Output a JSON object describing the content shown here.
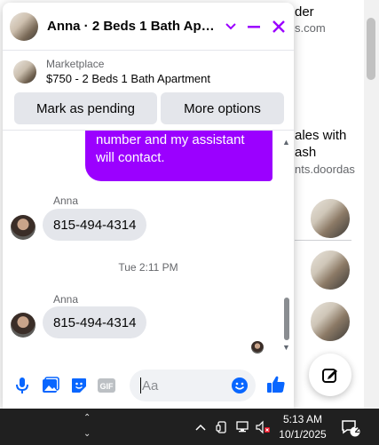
{
  "background": {
    "text_1": "der",
    "text_2": "s.com",
    "text_3": "ales with ash",
    "text_4": "nts.doordas"
  },
  "chat": {
    "title": "Anna · 2 Beds 1 Bath Apart…",
    "marketplace_label": "Marketplace",
    "listing_title": "$750 - 2 Beds 1 Bath Apartment",
    "mark_pending_label": "Mark as pending",
    "more_options_label": "More options",
    "outgoing_message": "number and my assistant will contact.",
    "sender_name_1": "Anna",
    "message_1": "815-494-4314",
    "timestamp": "Tue 2:11 PM",
    "sender_name_2": "Anna",
    "message_2": "815-494-4314",
    "input_placeholder": "Aa",
    "accent_color": "#9b00ff"
  },
  "taskbar": {
    "time": "5:13 AM",
    "date": "10/1/2025",
    "notification_count": "2"
  }
}
